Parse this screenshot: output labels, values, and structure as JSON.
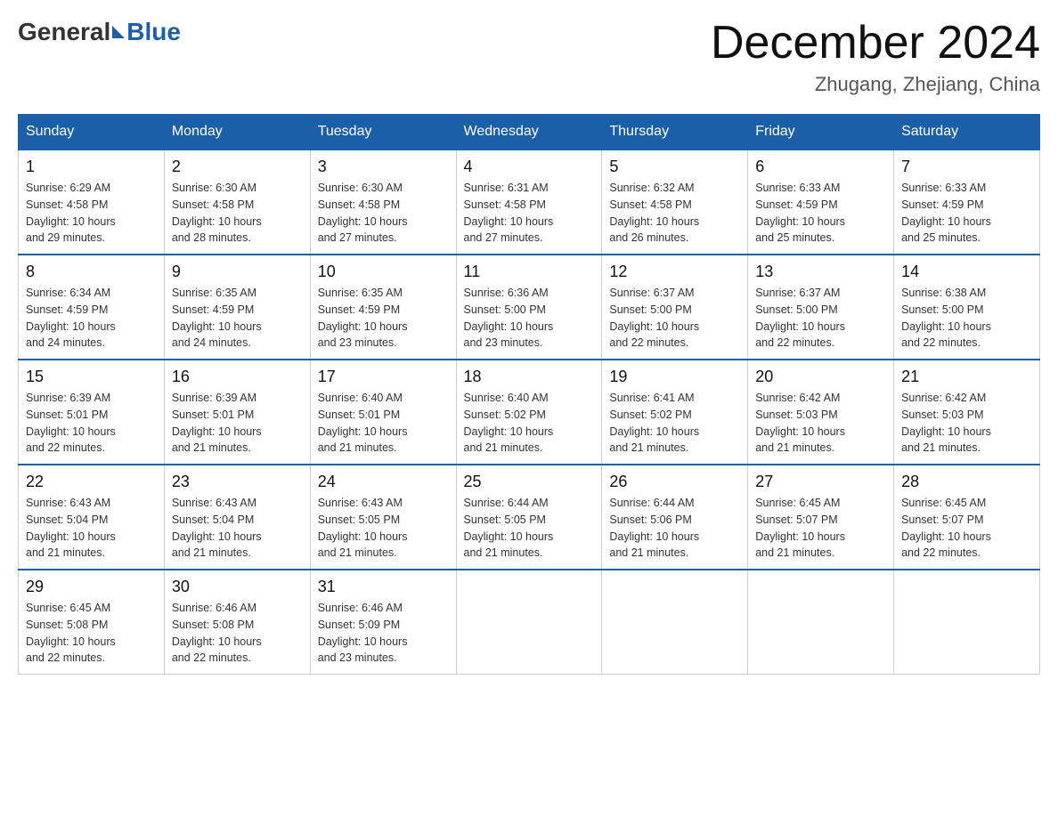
{
  "header": {
    "logo_general": "General",
    "logo_blue": "Blue",
    "month_title": "December 2024",
    "location": "Zhugang, Zhejiang, China"
  },
  "days_of_week": [
    "Sunday",
    "Monday",
    "Tuesday",
    "Wednesday",
    "Thursday",
    "Friday",
    "Saturday"
  ],
  "weeks": [
    [
      {
        "day": "1",
        "sunrise": "6:29 AM",
        "sunset": "4:58 PM",
        "daylight": "10 hours and 29 minutes."
      },
      {
        "day": "2",
        "sunrise": "6:30 AM",
        "sunset": "4:58 PM",
        "daylight": "10 hours and 28 minutes."
      },
      {
        "day": "3",
        "sunrise": "6:30 AM",
        "sunset": "4:58 PM",
        "daylight": "10 hours and 27 minutes."
      },
      {
        "day": "4",
        "sunrise": "6:31 AM",
        "sunset": "4:58 PM",
        "daylight": "10 hours and 27 minutes."
      },
      {
        "day": "5",
        "sunrise": "6:32 AM",
        "sunset": "4:58 PM",
        "daylight": "10 hours and 26 minutes."
      },
      {
        "day": "6",
        "sunrise": "6:33 AM",
        "sunset": "4:59 PM",
        "daylight": "10 hours and 25 minutes."
      },
      {
        "day": "7",
        "sunrise": "6:33 AM",
        "sunset": "4:59 PM",
        "daylight": "10 hours and 25 minutes."
      }
    ],
    [
      {
        "day": "8",
        "sunrise": "6:34 AM",
        "sunset": "4:59 PM",
        "daylight": "10 hours and 24 minutes."
      },
      {
        "day": "9",
        "sunrise": "6:35 AM",
        "sunset": "4:59 PM",
        "daylight": "10 hours and 24 minutes."
      },
      {
        "day": "10",
        "sunrise": "6:35 AM",
        "sunset": "4:59 PM",
        "daylight": "10 hours and 23 minutes."
      },
      {
        "day": "11",
        "sunrise": "6:36 AM",
        "sunset": "5:00 PM",
        "daylight": "10 hours and 23 minutes."
      },
      {
        "day": "12",
        "sunrise": "6:37 AM",
        "sunset": "5:00 PM",
        "daylight": "10 hours and 22 minutes."
      },
      {
        "day": "13",
        "sunrise": "6:37 AM",
        "sunset": "5:00 PM",
        "daylight": "10 hours and 22 minutes."
      },
      {
        "day": "14",
        "sunrise": "6:38 AM",
        "sunset": "5:00 PM",
        "daylight": "10 hours and 22 minutes."
      }
    ],
    [
      {
        "day": "15",
        "sunrise": "6:39 AM",
        "sunset": "5:01 PM",
        "daylight": "10 hours and 22 minutes."
      },
      {
        "day": "16",
        "sunrise": "6:39 AM",
        "sunset": "5:01 PM",
        "daylight": "10 hours and 21 minutes."
      },
      {
        "day": "17",
        "sunrise": "6:40 AM",
        "sunset": "5:01 PM",
        "daylight": "10 hours and 21 minutes."
      },
      {
        "day": "18",
        "sunrise": "6:40 AM",
        "sunset": "5:02 PM",
        "daylight": "10 hours and 21 minutes."
      },
      {
        "day": "19",
        "sunrise": "6:41 AM",
        "sunset": "5:02 PM",
        "daylight": "10 hours and 21 minutes."
      },
      {
        "day": "20",
        "sunrise": "6:42 AM",
        "sunset": "5:03 PM",
        "daylight": "10 hours and 21 minutes."
      },
      {
        "day": "21",
        "sunrise": "6:42 AM",
        "sunset": "5:03 PM",
        "daylight": "10 hours and 21 minutes."
      }
    ],
    [
      {
        "day": "22",
        "sunrise": "6:43 AM",
        "sunset": "5:04 PM",
        "daylight": "10 hours and 21 minutes."
      },
      {
        "day": "23",
        "sunrise": "6:43 AM",
        "sunset": "5:04 PM",
        "daylight": "10 hours and 21 minutes."
      },
      {
        "day": "24",
        "sunrise": "6:43 AM",
        "sunset": "5:05 PM",
        "daylight": "10 hours and 21 minutes."
      },
      {
        "day": "25",
        "sunrise": "6:44 AM",
        "sunset": "5:05 PM",
        "daylight": "10 hours and 21 minutes."
      },
      {
        "day": "26",
        "sunrise": "6:44 AM",
        "sunset": "5:06 PM",
        "daylight": "10 hours and 21 minutes."
      },
      {
        "day": "27",
        "sunrise": "6:45 AM",
        "sunset": "5:07 PM",
        "daylight": "10 hours and 21 minutes."
      },
      {
        "day": "28",
        "sunrise": "6:45 AM",
        "sunset": "5:07 PM",
        "daylight": "10 hours and 22 minutes."
      }
    ],
    [
      {
        "day": "29",
        "sunrise": "6:45 AM",
        "sunset": "5:08 PM",
        "daylight": "10 hours and 22 minutes."
      },
      {
        "day": "30",
        "sunrise": "6:46 AM",
        "sunset": "5:08 PM",
        "daylight": "10 hours and 22 minutes."
      },
      {
        "day": "31",
        "sunrise": "6:46 AM",
        "sunset": "5:09 PM",
        "daylight": "10 hours and 23 minutes."
      },
      null,
      null,
      null,
      null
    ]
  ],
  "labels": {
    "sunrise": "Sunrise:",
    "sunset": "Sunset:",
    "daylight": "Daylight:"
  }
}
